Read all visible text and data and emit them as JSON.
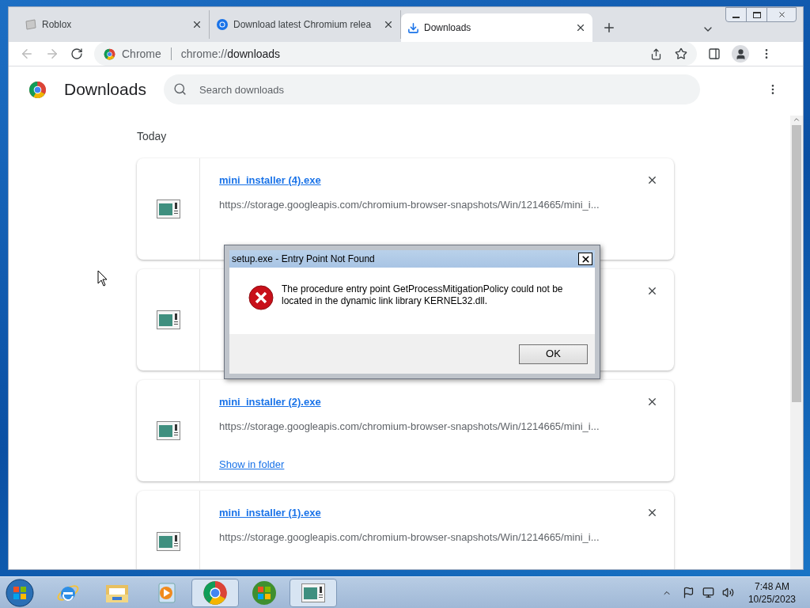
{
  "tabs": [
    {
      "title": "Roblox",
      "kind": "page",
      "selected": false
    },
    {
      "title": "Download latest Chromium relea",
      "kind": "site",
      "selected": false
    },
    {
      "title": "Downloads",
      "kind": "download",
      "selected": true
    }
  ],
  "address": {
    "origin_label": "Chrome",
    "url_host": "chrome://",
    "url_path": "downloads"
  },
  "page": {
    "title": "Downloads",
    "search_placeholder": "Search downloads",
    "section": "Today"
  },
  "downloads": [
    {
      "kind": "shown",
      "file_name": "mini_installer (4).exe",
      "url": "https://storage.googleapis.com/chromium-browser-snapshots/Win/1214665/mini_i..."
    },
    {
      "kind": "covered"
    },
    {
      "kind": "shown",
      "file_name": "mini_installer (2).exe",
      "url": "https://storage.googleapis.com/chromium-browser-snapshots/Win/1214665/mini_i...",
      "action": "Show in folder"
    },
    {
      "kind": "shown",
      "file_name": "mini_installer (1).exe",
      "url": "https://storage.googleapis.com/chromium-browser-snapshots/Win/1214665/mini_i..."
    }
  ],
  "dialog": {
    "title": "setup.exe - Entry Point Not Found",
    "message": "The procedure entry point GetProcessMitigationPolicy could not be located in the dynamic link library KERNEL32.dll.",
    "button": "OK"
  },
  "taskbar": {
    "items": [
      {
        "kind": "ie",
        "selected": false
      },
      {
        "kind": "explorer",
        "selected": false
      },
      {
        "kind": "media",
        "selected": false
      },
      {
        "kind": "chrome",
        "selected": true
      },
      {
        "kind": "windows",
        "selected": false
      },
      {
        "kind": "app",
        "selected": true
      }
    ],
    "time": "7:48 AM",
    "date": "10/25/2023"
  }
}
